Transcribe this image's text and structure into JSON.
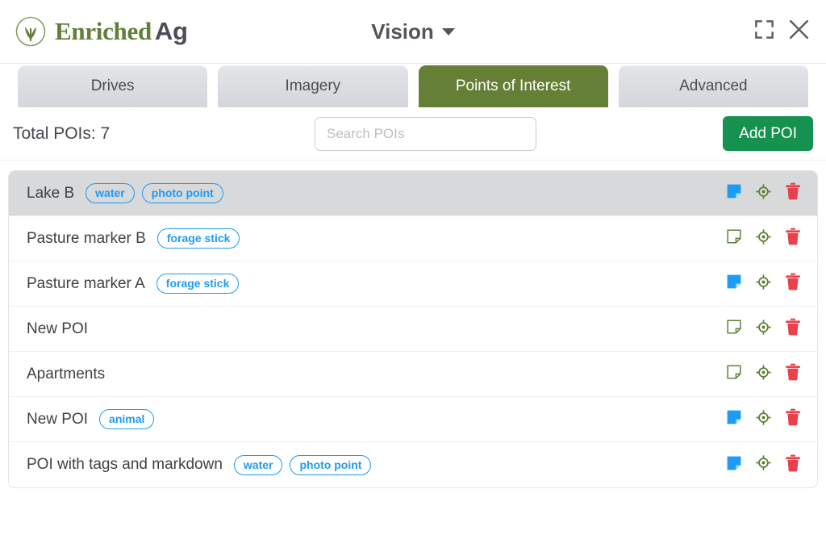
{
  "brand": {
    "word1": "Enriched",
    "word2": "Ag",
    "logo_icon": "grass-sprout-circle-icon"
  },
  "header": {
    "title": "Vision",
    "dropdown_icon": "chevron-down-icon",
    "fullscreen_icon": "fullscreen-expand-icon",
    "close_icon": "close-icon"
  },
  "tabs": [
    {
      "label": "Drives",
      "active": false
    },
    {
      "label": "Imagery",
      "active": false
    },
    {
      "label": "Points of Interest",
      "active": true
    },
    {
      "label": "Advanced",
      "active": false
    }
  ],
  "toolbar": {
    "total_label": "Total POIs: 7",
    "search_placeholder": "Search POIs",
    "search_value": "",
    "add_button": "Add POI"
  },
  "colors": {
    "active_tab": "#667f36",
    "add_button": "#17914f",
    "tag": "#1e9bf5",
    "note_filled": "#1e9bf5",
    "note_empty_outline": "#5f8038",
    "locate": "#5f7f35",
    "delete": "#e8414c",
    "selected_row": "#d8d9da"
  },
  "actions": {
    "note_icon": "note-icon",
    "locate_icon": "locate-target-icon",
    "delete_icon": "trash-icon"
  },
  "poi_list": [
    {
      "name": "Lake B",
      "tags": [
        "water",
        "photo point"
      ],
      "selected": true,
      "note_filled": true
    },
    {
      "name": "Pasture marker B",
      "tags": [
        "forage stick"
      ],
      "selected": false,
      "note_filled": false
    },
    {
      "name": "Pasture marker A",
      "tags": [
        "forage stick"
      ],
      "selected": false,
      "note_filled": true
    },
    {
      "name": "New POI",
      "tags": [],
      "selected": false,
      "note_filled": false
    },
    {
      "name": "Apartments",
      "tags": [],
      "selected": false,
      "note_filled": false
    },
    {
      "name": "New POI",
      "tags": [
        "animal"
      ],
      "selected": false,
      "note_filled": true
    },
    {
      "name": "POI with tags and markdown",
      "tags": [
        "water",
        "photo point"
      ],
      "selected": false,
      "note_filled": true
    }
  ]
}
